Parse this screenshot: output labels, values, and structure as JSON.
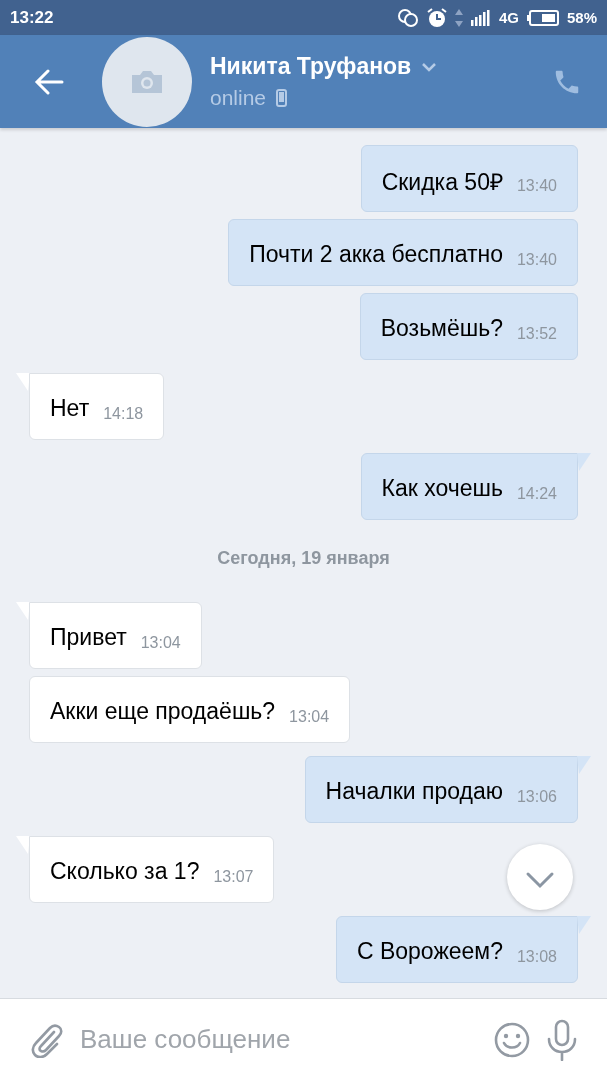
{
  "status_bar": {
    "time": "13:22",
    "network": "4G",
    "battery": "58%"
  },
  "header": {
    "name": "Никита Труфанов",
    "status": "online"
  },
  "messages": [
    {
      "kind": "out",
      "text": "Скидка 50₽",
      "time": "13:40",
      "tail": false
    },
    {
      "kind": "out",
      "text": "Почти 2 акка бесплатно",
      "time": "13:40",
      "tail": false
    },
    {
      "kind": "out",
      "text": "Возьмёшь?",
      "time": "13:52",
      "tail": false
    },
    {
      "kind": "in",
      "text": "Нет",
      "time": "14:18",
      "tail": true
    },
    {
      "kind": "out",
      "text": "Как хочешь",
      "time": "14:24",
      "tail": true
    },
    {
      "kind": "date",
      "text": "Сегодня, 19 января"
    },
    {
      "kind": "in",
      "text": "Привет",
      "time": "13:04",
      "tail": true
    },
    {
      "kind": "in",
      "text": "Акки еще продаёшь?",
      "time": "13:04",
      "tail": false
    },
    {
      "kind": "out",
      "text": "Началки продаю",
      "time": "13:06",
      "tail": true
    },
    {
      "kind": "in",
      "text": "Сколько за 1?",
      "time": "13:07",
      "tail": true
    },
    {
      "kind": "out",
      "text": "С Ворожеем?",
      "time": "13:08",
      "tail": true
    }
  ],
  "composer": {
    "placeholder": "Ваше сообщение"
  }
}
